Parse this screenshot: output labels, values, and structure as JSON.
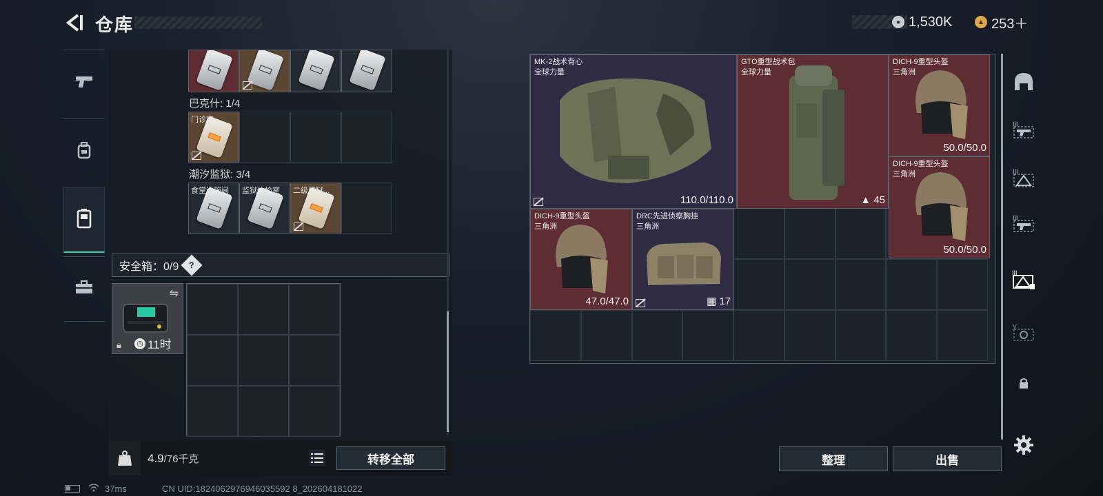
{
  "header": {
    "title": "仓库",
    "currency1": "1,530K",
    "currency2": "253＋"
  },
  "left": {
    "section1_label": "巴克什: 1/4",
    "section1_item": "门诊室",
    "section2_label": "潮汐监狱: 3/4",
    "section2_items": [
      "食堂洗碗间",
      "监狱体检室",
      "二级监狱..."
    ],
    "safebox_label": "安全箱：0/9",
    "safebox_help": "?",
    "safebox_timer": "11时",
    "weight_value": "4.9",
    "weight_total": "/76千克",
    "transfer_all": "转移全部"
  },
  "right": {
    "items": [
      {
        "name": "MK-2战术背心",
        "sub": "全球力量",
        "value": "110.0/110.0"
      },
      {
        "name": "GTO重型战术包",
        "sub": "全球力量",
        "value": "45"
      },
      {
        "name": "DICH-9重型头盔",
        "sub": "三角洲",
        "value": "50.0/50.0"
      },
      {
        "name": "DICH-9重型头盔",
        "sub": "三角洲",
        "value": "50.0/50.0"
      },
      {
        "name": "DICH-9重型头盔",
        "sub": "三角洲",
        "value": "47.0/47.0"
      },
      {
        "name": "DRC先进侦察胸挂",
        "sub": "三角洲",
        "value": "17"
      }
    ],
    "sort": "整理",
    "sell": "出售"
  },
  "status": {
    "ping": "37ms",
    "uid": "CN UID:1824062976946035592 8_202604181022"
  },
  "colors": {
    "accent": "#3fd7b0",
    "red_cell": "#5e2d33",
    "purple_cell": "#2f2b44"
  },
  "icons": [
    "back-arrow-icon",
    "silver-coin-icon",
    "gold-coin-icon",
    "pistol-icon",
    "backpack-icon",
    "vest-icon",
    "toolbox-icon",
    "helmet-icon",
    "lock-icon",
    "gear-icon",
    "list-icon",
    "weight-icon",
    "clock-icon",
    "swap-icon",
    "no-transfer-icon"
  ]
}
